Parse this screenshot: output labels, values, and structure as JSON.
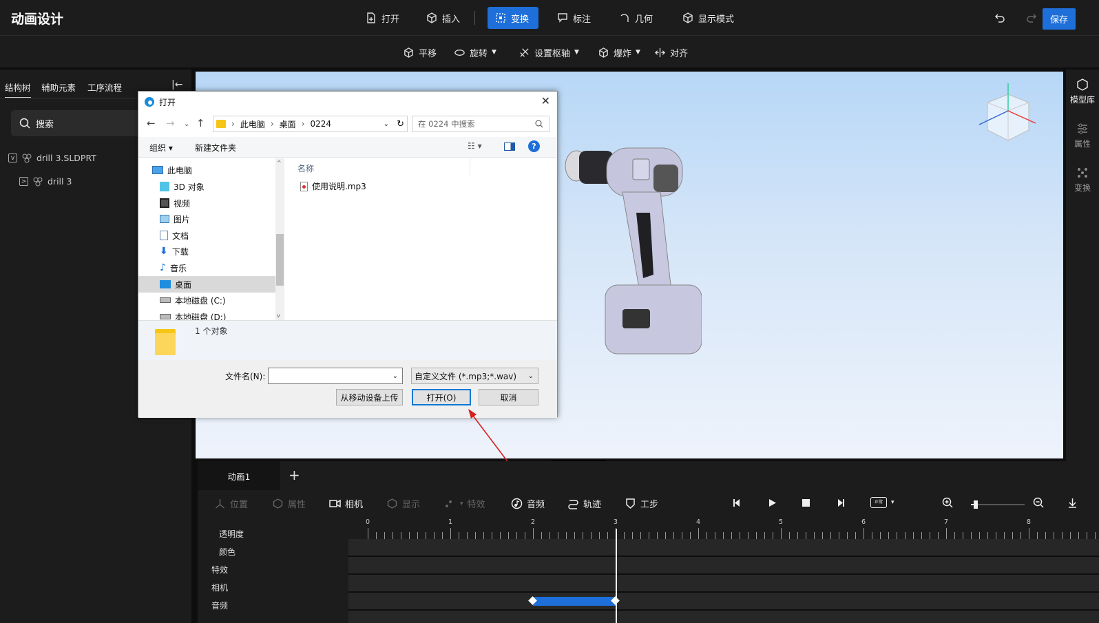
{
  "app": {
    "title": "动画设计",
    "save_label": "保存"
  },
  "top_toolbar": [
    {
      "label": "打开",
      "icon": "file-open-icon",
      "active": false
    },
    {
      "label": "插入",
      "icon": "cube-insert-icon",
      "active": false
    },
    {
      "label": "变换",
      "icon": "transform-icon",
      "active": true
    },
    {
      "label": "标注",
      "icon": "annotation-icon",
      "active": false
    },
    {
      "label": "几何",
      "icon": "geometry-icon",
      "active": false
    },
    {
      "label": "显示模式",
      "icon": "display-mode-icon",
      "active": false
    }
  ],
  "sub_toolbar": [
    {
      "label": "平移",
      "icon": "translate-icon",
      "dropdown": false
    },
    {
      "label": "旋转",
      "icon": "rotate-icon",
      "dropdown": true
    },
    {
      "label": "设置枢轴",
      "icon": "pivot-icon",
      "dropdown": true
    },
    {
      "label": "爆炸",
      "icon": "explode-icon",
      "dropdown": true
    },
    {
      "label": "对齐",
      "icon": "align-icon",
      "dropdown": false
    }
  ],
  "left_panel": {
    "tabs": [
      "结构树",
      "辅助元素",
      "工序流程"
    ],
    "active_tab": "结构树",
    "search_placeholder": "搜索",
    "tree": [
      {
        "label": "drill 3.SLDPRT",
        "level": 0,
        "toggle": "v"
      },
      {
        "label": "drill 3",
        "level": 1,
        "toggle": ">"
      }
    ]
  },
  "right_panel": [
    {
      "label": "模型库",
      "icon": "model-library-icon",
      "active": true
    },
    {
      "label": "属性",
      "icon": "properties-icon",
      "active": false
    },
    {
      "label": "变换",
      "icon": "transform-panel-icon",
      "active": false
    }
  ],
  "dialog": {
    "title": "打开",
    "breadcrumb": [
      "此电脑",
      "桌面",
      "0224"
    ],
    "search_placeholder": "在 0224 中搜索",
    "organize_label": "组织",
    "new_folder_label": "新建文件夹",
    "nav_items": [
      {
        "label": "此电脑",
        "icon": "computer-icon"
      },
      {
        "label": "3D 对象",
        "icon": "3d-objects-icon"
      },
      {
        "label": "视频",
        "icon": "video-icon"
      },
      {
        "label": "图片",
        "icon": "picture-icon"
      },
      {
        "label": "文档",
        "icon": "document-icon"
      },
      {
        "label": "下载",
        "icon": "download-icon"
      },
      {
        "label": "音乐",
        "icon": "music-icon"
      },
      {
        "label": "桌面",
        "icon": "desktop-icon",
        "selected": true
      },
      {
        "label": "本地磁盘 (C:)",
        "icon": "disk-icon"
      },
      {
        "label": "本地磁盘 (D:)",
        "icon": "disk-icon"
      }
    ],
    "column_header": "名称",
    "files": [
      {
        "name": "使用说明.mp3",
        "icon": "audio-file-icon"
      }
    ],
    "object_count": "1 个对象",
    "filename_label": "文件名(N):",
    "filename_value": "",
    "filetype_value": "自定义文件 (*.mp3;*.wav)",
    "upload_button": "从移动设备上传",
    "open_button": "打开(O)",
    "cancel_button": "取消"
  },
  "timeline": {
    "tab": "动画1",
    "add_tab": "+",
    "toolbar": [
      {
        "label": "位置",
        "icon": "position-icon",
        "enabled": false
      },
      {
        "label": "属性",
        "icon": "attribute-icon",
        "enabled": false
      },
      {
        "label": "相机",
        "icon": "camera-icon",
        "enabled": true
      },
      {
        "label": "显示",
        "icon": "display-icon",
        "enabled": false
      },
      {
        "label": "特效",
        "icon": "effects-icon",
        "enabled": false
      },
      {
        "label": "音频",
        "icon": "audio-icon",
        "enabled": true
      },
      {
        "label": "轨迹",
        "icon": "trajectory-icon",
        "enabled": true
      },
      {
        "label": "工步",
        "icon": "step-icon",
        "enabled": true
      }
    ],
    "speed_label": "正常",
    "ruler_ticks": [
      "0",
      "1",
      "2",
      "3",
      "4",
      "5",
      "6",
      "7",
      "8"
    ],
    "tracks": [
      "透明度",
      "颜色",
      "特效",
      "相机",
      "音频"
    ],
    "playhead_seconds": 3,
    "camera_keyframes": [
      2,
      3
    ],
    "zoom_level": 0.05,
    "colors": {
      "accent": "#1e6fd9",
      "keyframe_bar": "#1e6fd9",
      "arrow": "#d42020"
    }
  }
}
